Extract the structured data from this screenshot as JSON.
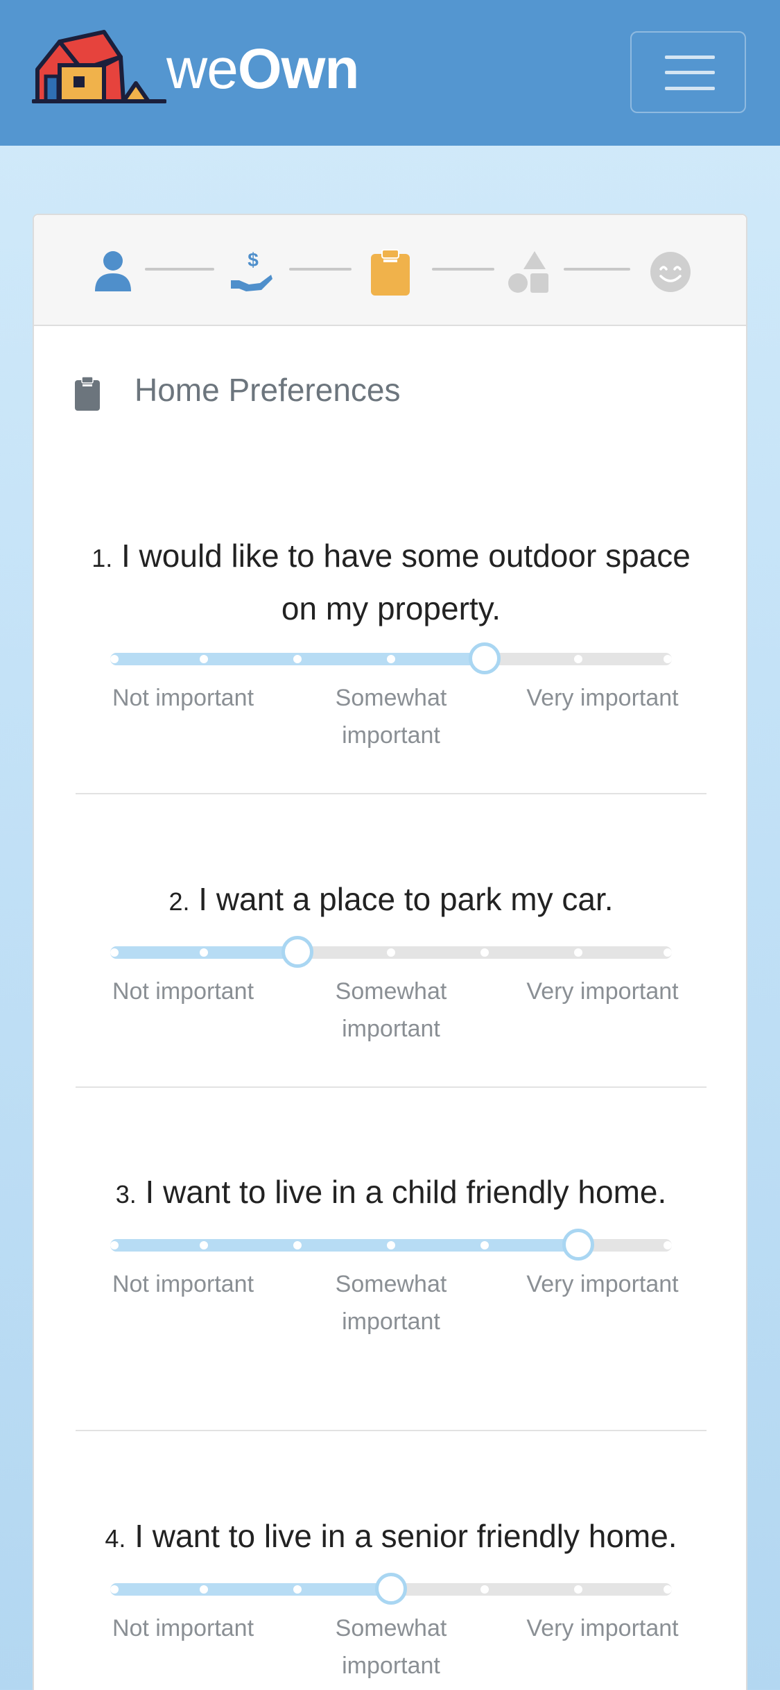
{
  "brand": {
    "we": "we",
    "own": "Own"
  },
  "steps": [
    {
      "icon": "user-icon",
      "state": "done",
      "color": "#4f8fcb"
    },
    {
      "icon": "hand-dollar-icon",
      "state": "done",
      "color": "#4f8fcb"
    },
    {
      "icon": "clipboard-icon",
      "state": "active",
      "color": "#f0b24b"
    },
    {
      "icon": "shapes-icon",
      "state": "pending",
      "color": "#cfcfcf"
    },
    {
      "icon": "smile-icon",
      "state": "pending",
      "color": "#cfcfcf"
    }
  ],
  "section": {
    "title": "Home Preferences"
  },
  "scale_labels": {
    "low": "Not important",
    "mid": "Somewhat important",
    "high": "Very important"
  },
  "questions": [
    {
      "num": "1.",
      "text": "I would like to have some outdoor space on my property.",
      "value": 5,
      "max": 7
    },
    {
      "num": "2.",
      "text": "I want a place to park my car.",
      "value": 3,
      "max": 7
    },
    {
      "num": "3.",
      "text": "I want to live in a child friendly home.",
      "value": 6,
      "max": 7
    },
    {
      "num": "4.",
      "text": "I want to live in a senior friendly home.",
      "value": 4,
      "max": 7
    }
  ],
  "colors": {
    "header": "#5496d0",
    "slider_fill": "#b7dcf4",
    "slider_handle": "#a9d6f2",
    "active_step": "#f0b24b"
  }
}
